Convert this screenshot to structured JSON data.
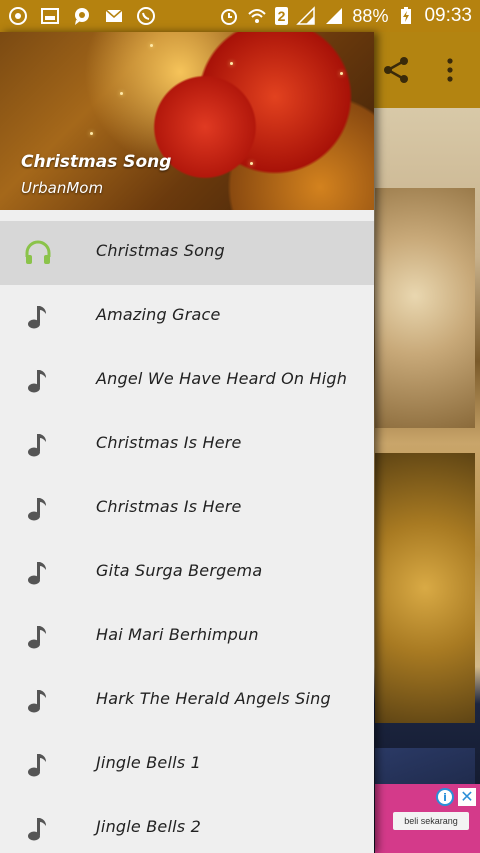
{
  "status_bar": {
    "battery": "88%",
    "time": "09:33",
    "sim_slot": "2"
  },
  "drawer": {
    "header": {
      "title": "Christmas Song",
      "subtitle": "UrbanMom"
    },
    "items": [
      {
        "label": "Christmas Song",
        "icon": "headphones-icon",
        "active": true
      },
      {
        "label": "Amazing Grace",
        "icon": "music-note-icon",
        "active": false
      },
      {
        "label": "Angel We Have Heard On High",
        "icon": "music-note-icon",
        "active": false
      },
      {
        "label": "Christmas Is Here",
        "icon": "music-note-icon",
        "active": false
      },
      {
        "label": "Christmas Is Here",
        "icon": "music-note-icon",
        "active": false
      },
      {
        "label": "Gita Surga Bergema",
        "icon": "music-note-icon",
        "active": false
      },
      {
        "label": "Hai Mari Berhimpun",
        "icon": "music-note-icon",
        "active": false
      },
      {
        "label": "Hark The Herald Angels Sing",
        "icon": "music-note-icon",
        "active": false
      },
      {
        "label": "Jingle Bells 1",
        "icon": "music-note-icon",
        "active": false
      },
      {
        "label": "Jingle Bells 2",
        "icon": "music-note-icon",
        "active": false
      }
    ]
  },
  "ad": {
    "button_label": "beli sekarang"
  },
  "colors": {
    "status_bar": "#b5820f",
    "toolbar": "#b38411",
    "active_icon": "#8bc34a",
    "inactive_icon": "#555555",
    "drawer_bg": "#efefef",
    "active_row": "#d7d7d7"
  }
}
